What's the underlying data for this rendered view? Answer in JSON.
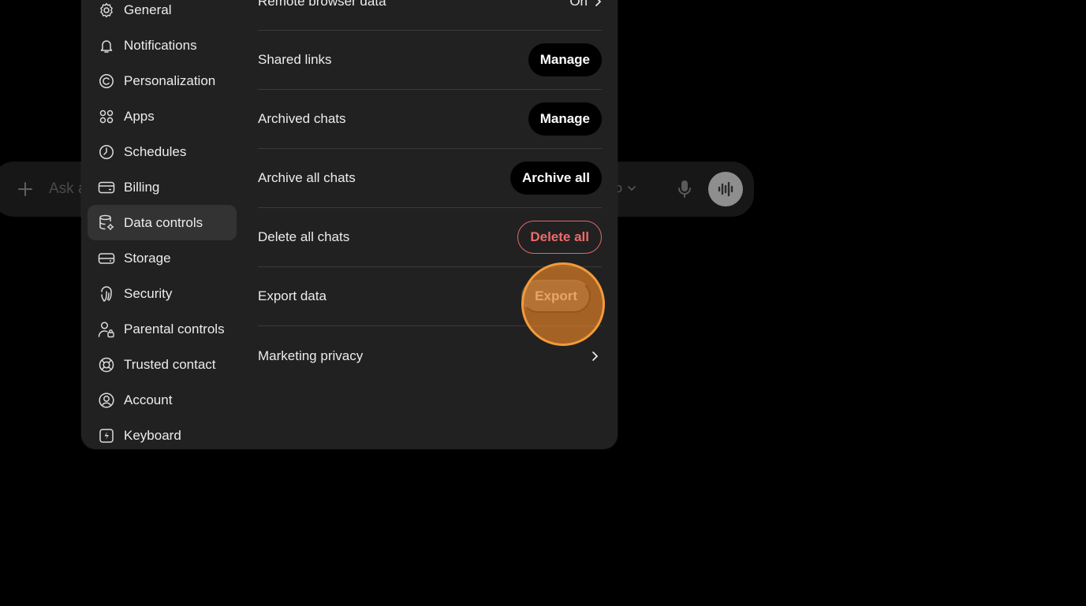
{
  "composer": {
    "placeholder": "Ask a",
    "model_label": "ro"
  },
  "sidebar": {
    "items": [
      {
        "label": "General",
        "icon": "gear-icon"
      },
      {
        "label": "Notifications",
        "icon": "bell-icon"
      },
      {
        "label": "Personalization",
        "icon": "palette-icon"
      },
      {
        "label": "Apps",
        "icon": "apps-grid-icon"
      },
      {
        "label": "Schedules",
        "icon": "clock-icon"
      },
      {
        "label": "Billing",
        "icon": "credit-card-icon"
      },
      {
        "label": "Data controls",
        "icon": "database-gear-icon",
        "active": true
      },
      {
        "label": "Storage",
        "icon": "storage-drive-icon"
      },
      {
        "label": "Security",
        "icon": "fingerprint-icon"
      },
      {
        "label": "Parental controls",
        "icon": "user-lock-icon"
      },
      {
        "label": "Trusted contact",
        "icon": "lifebuoy-icon"
      },
      {
        "label": "Account",
        "icon": "user-circle-icon"
      },
      {
        "label": "Keyboard",
        "icon": "keyboard-icon"
      }
    ]
  },
  "content": {
    "rows": [
      {
        "label": "Remote browser data",
        "value": "On"
      },
      {
        "label": "Shared links",
        "button": "Manage"
      },
      {
        "label": "Archived chats",
        "button": "Manage"
      },
      {
        "label": "Archive all chats",
        "button": "Archive all"
      },
      {
        "label": "Delete all chats",
        "button": "Delete all"
      },
      {
        "label": "Export data",
        "button": "Export"
      },
      {
        "label": "Marketing privacy"
      }
    ]
  },
  "colors": {
    "modal_bg": "#212121",
    "active_nav_bg": "#333333",
    "danger": "#ef6a6a",
    "focus_highlight": "#f39a3a"
  }
}
